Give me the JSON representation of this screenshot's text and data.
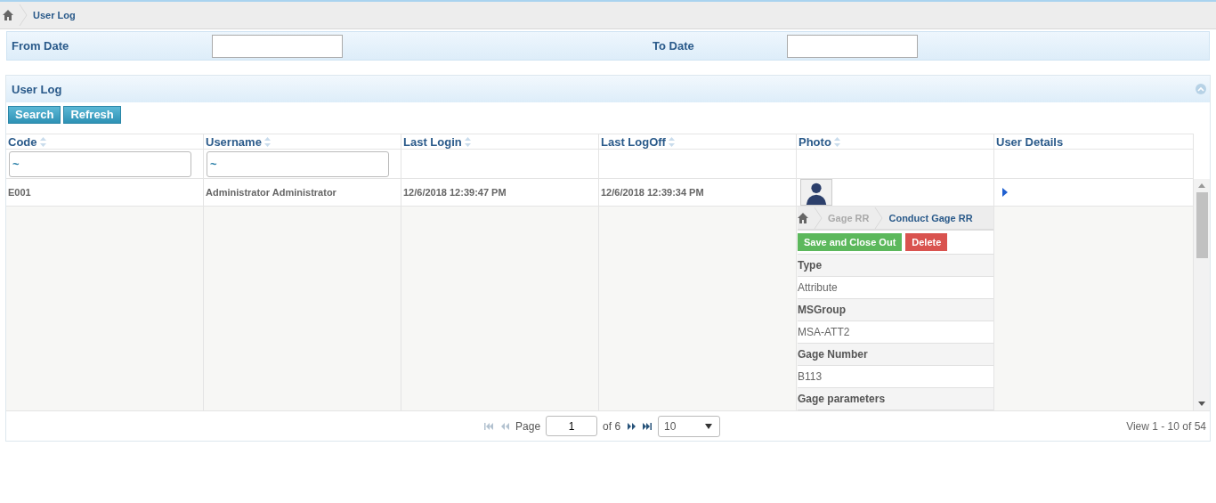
{
  "breadcrumb": {
    "items": [
      "User Log"
    ]
  },
  "filters": [
    {
      "label": "From Date"
    },
    {
      "label": "To Date"
    }
  ],
  "panel": {
    "title": "User Log",
    "expanded": true
  },
  "toolbar": [
    "Search",
    "Refresh"
  ],
  "table": {
    "columns": [
      {
        "label": "Code",
        "sortable": true,
        "filter": "~"
      },
      {
        "label": "Username",
        "sortable": true,
        "filter": "~"
      },
      {
        "label": "Last Login",
        "sortable": true
      },
      {
        "label": "Last LogOff",
        "sortable": true
      },
      {
        "label": "Photo",
        "sortable": true
      },
      {
        "label": "User Details",
        "sortable": false
      }
    ],
    "rows": [
      {
        "cells": [
          "E001",
          "Administrator Administrator",
          "12/6/2018 12:39:47 PM",
          "12/6/2018 12:39:34 PM"
        ],
        "expanded": false
      }
    ]
  },
  "detail": {
    "breadcrumb": [
      "Gage RR",
      "Conduct Gage RR"
    ],
    "buttons": [
      {
        "label": "Save and Close Out",
        "kind": "success"
      },
      {
        "label": "Delete",
        "kind": "danger"
      }
    ],
    "fields": [
      {
        "label": "Type",
        "value": "Attribute"
      },
      {
        "label": "MSGroup",
        "value": "MSA-ATT2"
      },
      {
        "label": "Gage Number",
        "value": "B113"
      },
      {
        "label": "Gage parameters"
      }
    ]
  },
  "pager": {
    "nav": [
      {
        "kind": "first",
        "disabled": true
      },
      {
        "kind": "prev",
        "disabled": true
      },
      {
        "kind": "next",
        "disabled": false
      },
      {
        "kind": "last",
        "disabled": false
      }
    ],
    "page_label": "Page",
    "page": "1",
    "of": "of 6",
    "page_size": "10",
    "summary": "View 1 - 10 of 54"
  }
}
